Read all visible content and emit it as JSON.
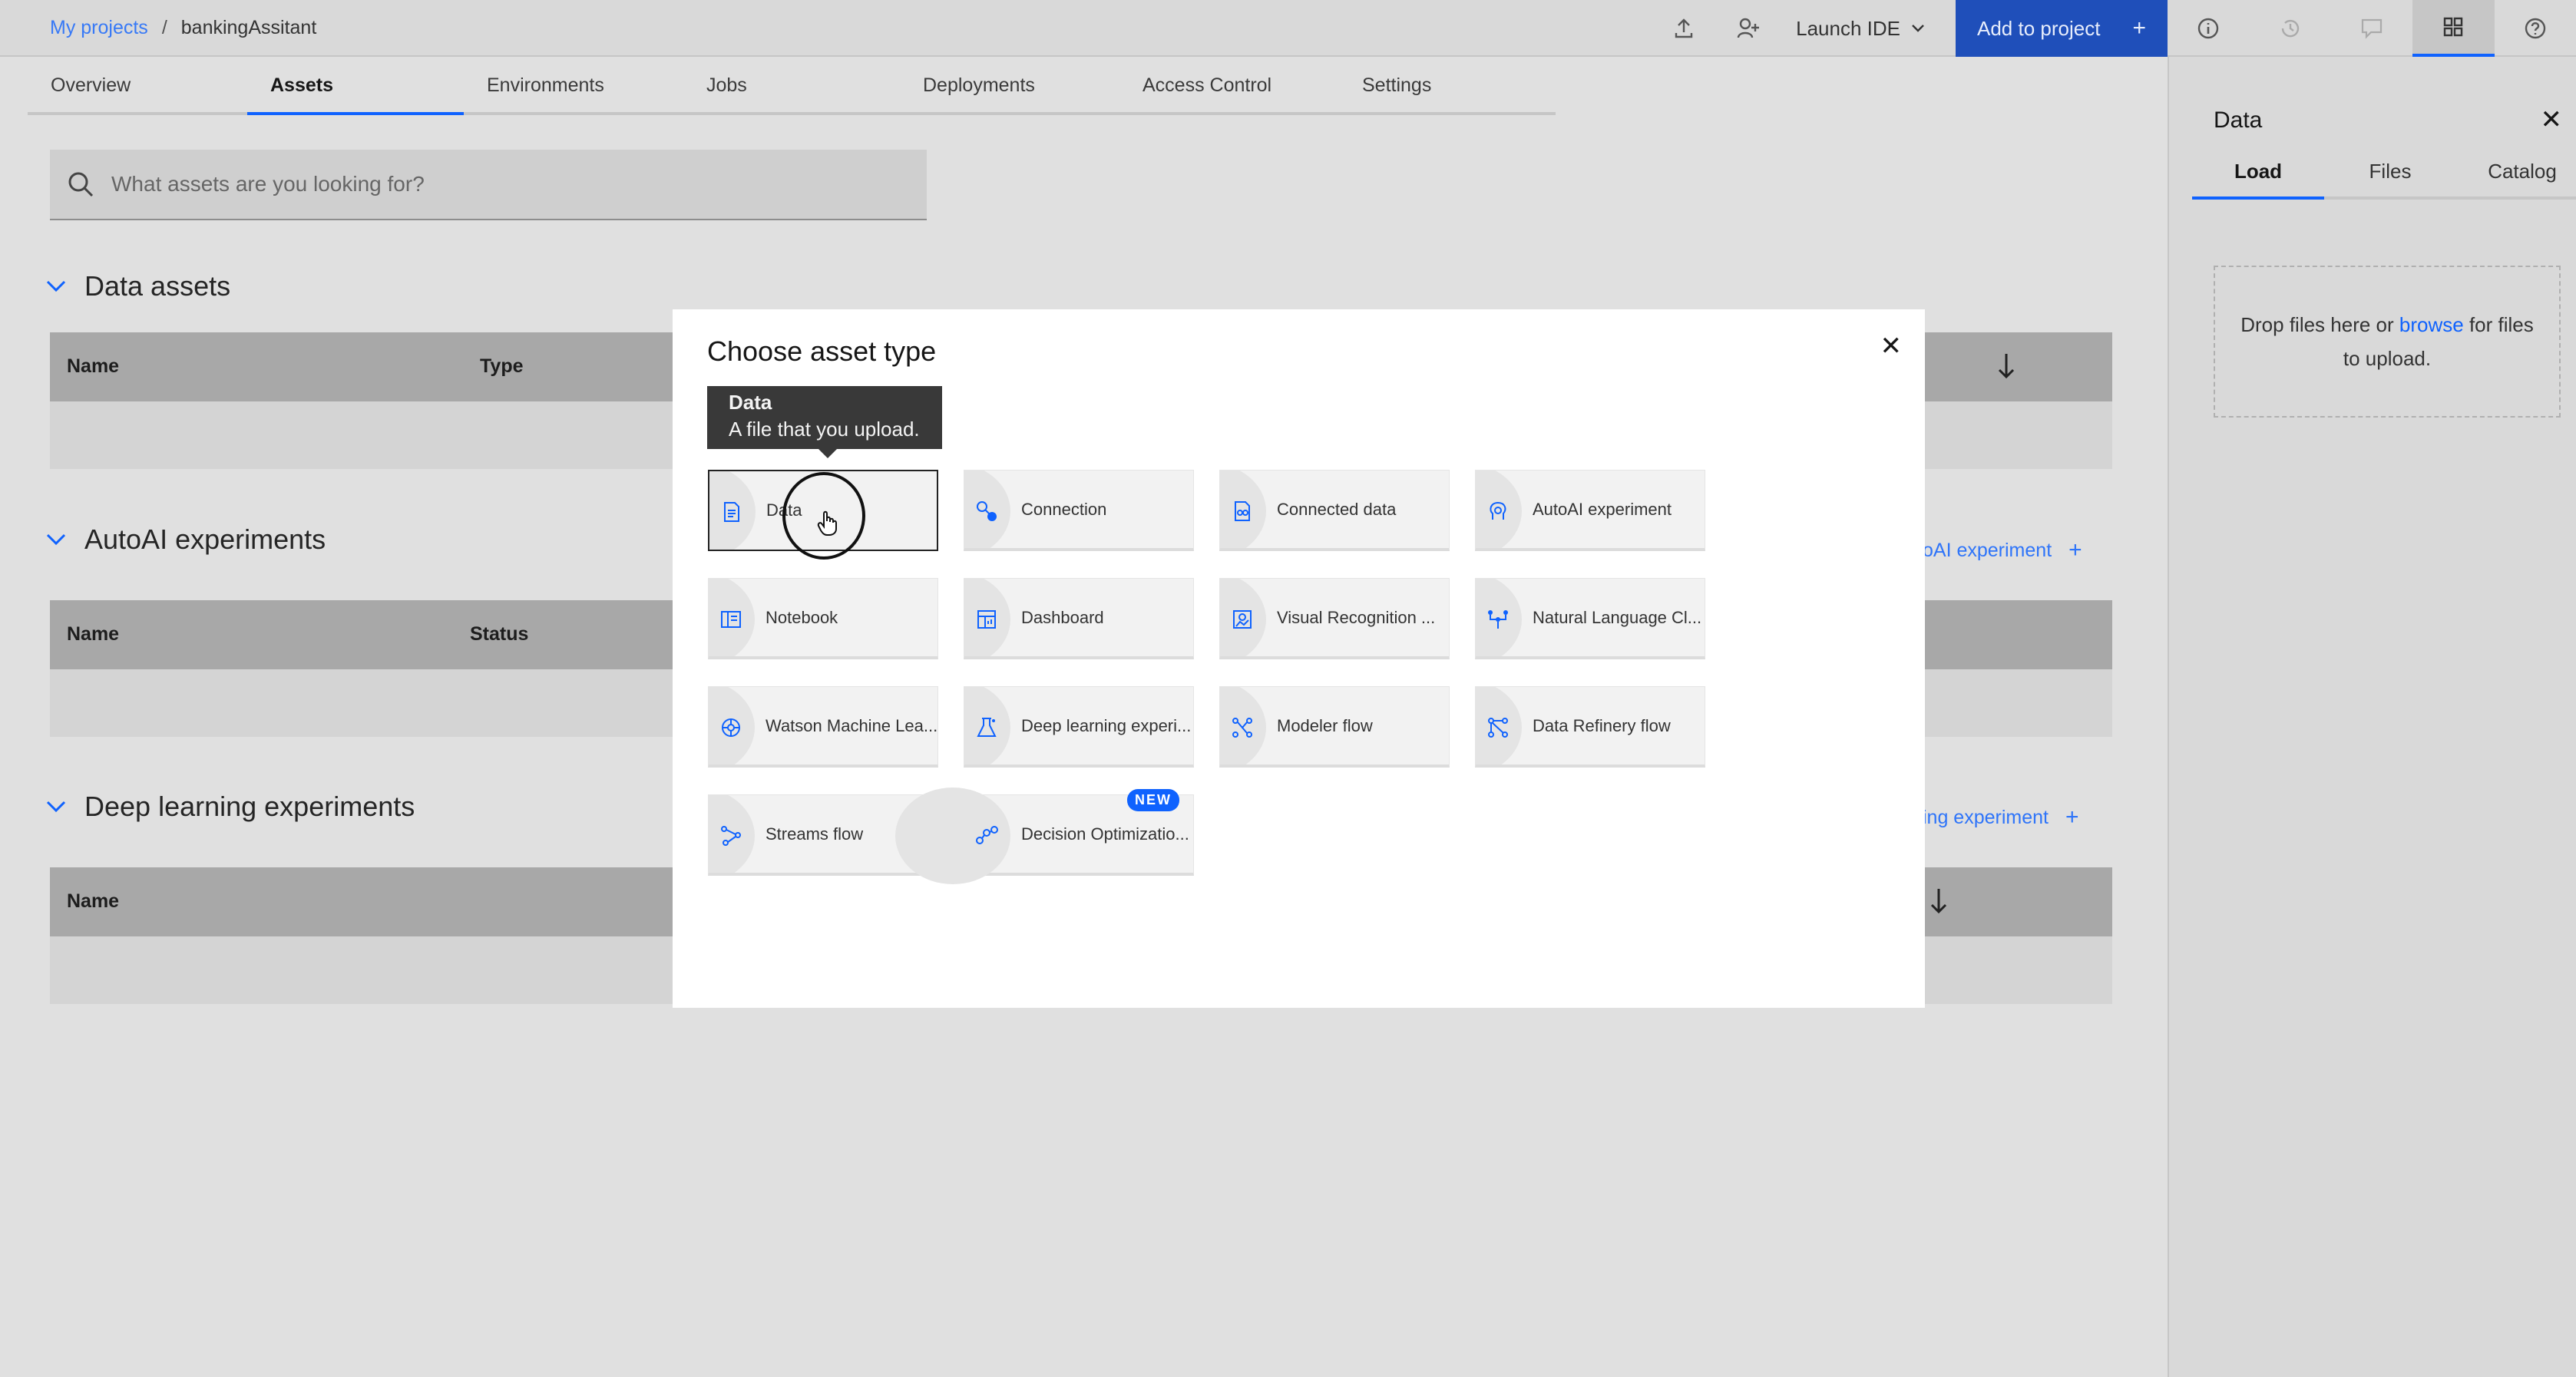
{
  "header": {
    "breadcrumb_root": "My projects",
    "breadcrumb_sep": "/",
    "breadcrumb_current": "bankingAssitant",
    "launch_ide": "Launch IDE",
    "add_to_project": "Add to project",
    "add_icon": "+"
  },
  "tabs": [
    {
      "label": "Overview"
    },
    {
      "label": "Assets"
    },
    {
      "label": "Environments"
    },
    {
      "label": "Jobs"
    },
    {
      "label": "Deployments"
    },
    {
      "label": "Access Control"
    },
    {
      "label": "Settings"
    }
  ],
  "search": {
    "placeholder": "What assets are you looking for?"
  },
  "sections": {
    "data_assets": {
      "title": "Data assets",
      "col1": "Name",
      "col2": "Type"
    },
    "autoai": {
      "title": "AutoAI experiments",
      "col1": "Name",
      "col2": "Status",
      "link": "oAI experiment",
      "link_icon": "+"
    },
    "deep_learning": {
      "title": "Deep learning experiments",
      "col1": "Name",
      "link": "ing experiment",
      "link_icon": "+"
    }
  },
  "panel": {
    "title": "Data",
    "close": "✕",
    "tabs": [
      {
        "label": "Load"
      },
      {
        "label": "Files"
      },
      {
        "label": "Catalog"
      }
    ],
    "drop_before": "Drop files here or ",
    "drop_link": "browse",
    "drop_after": " for files to upload."
  },
  "modal": {
    "title": "Choose asset type",
    "close": "✕",
    "tooltip_title": "Data",
    "tooltip_desc": "A file that you upload.",
    "new_badge": "NEW",
    "tiles": [
      {
        "label": "Data",
        "icon": "data-file-icon"
      },
      {
        "label": "Connection",
        "icon": "connection-icon"
      },
      {
        "label": "Connected data",
        "icon": "connected-data-icon"
      },
      {
        "label": "AutoAI experiment",
        "icon": "autoai-icon"
      },
      {
        "label": "Notebook",
        "icon": "notebook-icon"
      },
      {
        "label": "Dashboard",
        "icon": "dashboard-icon"
      },
      {
        "label": "Visual Recognition ...",
        "icon": "visual-recognition-icon"
      },
      {
        "label": "Natural Language Cl...",
        "icon": "natural-language-icon"
      },
      {
        "label": "Watson Machine Lea...",
        "icon": "watson-ml-icon"
      },
      {
        "label": "Deep learning experi...",
        "icon": "deep-learning-icon"
      },
      {
        "label": "Modeler flow",
        "icon": "modeler-flow-icon"
      },
      {
        "label": "Data Refinery flow",
        "icon": "data-refinery-icon"
      },
      {
        "label": "Streams flow",
        "icon": "streams-flow-icon"
      },
      {
        "label": "Decision Optimizatio...",
        "icon": "decision-optimization-icon"
      }
    ]
  },
  "colors": {
    "accent": "#0f62fe",
    "button_bg": "#1f4fba",
    "tooltip_bg": "#393939"
  }
}
